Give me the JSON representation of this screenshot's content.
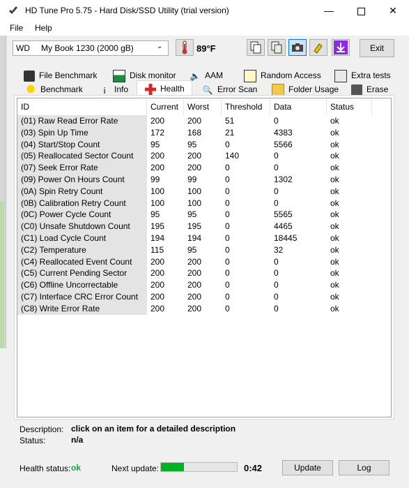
{
  "window": {
    "title": "HD Tune Pro 5.75 - Hard Disk/SSD Utility (trial version)"
  },
  "menu": {
    "file": "File",
    "help": "Help"
  },
  "toolbar": {
    "drive_brand": "WD",
    "drive_name": "My Book 1230 (2000 gB)",
    "temperature": "89°F",
    "exit_label": "Exit",
    "icons": [
      "copy-icon",
      "copy-text-icon",
      "camera-icon",
      "settings-icon",
      "save-download-icon"
    ]
  },
  "tabs_top": [
    "File Benchmark",
    "Disk monitor",
    "AAM",
    "Random Access",
    "Extra tests"
  ],
  "tabs_bottom": [
    "Benchmark",
    "Info",
    "Health",
    "Error Scan",
    "Folder Usage",
    "Erase"
  ],
  "active_tab": "Health",
  "table": {
    "headers": [
      "ID",
      "Current",
      "Worst",
      "Threshold",
      "Data",
      "Status"
    ],
    "rows": [
      [
        "(01) Raw Read Error Rate",
        "200",
        "200",
        "51",
        "0",
        "ok"
      ],
      [
        "(03) Spin Up Time",
        "172",
        "168",
        "21",
        "4383",
        "ok"
      ],
      [
        "(04) Start/Stop Count",
        "95",
        "95",
        "0",
        "5566",
        "ok"
      ],
      [
        "(05) Reallocated Sector Count",
        "200",
        "200",
        "140",
        "0",
        "ok"
      ],
      [
        "(07) Seek Error Rate",
        "200",
        "200",
        "0",
        "0",
        "ok"
      ],
      [
        "(09) Power On Hours Count",
        "99",
        "99",
        "0",
        "1302",
        "ok"
      ],
      [
        "(0A) Spin Retry Count",
        "100",
        "100",
        "0",
        "0",
        "ok"
      ],
      [
        "(0B) Calibration Retry Count",
        "100",
        "100",
        "0",
        "0",
        "ok"
      ],
      [
        "(0C) Power Cycle Count",
        "95",
        "95",
        "0",
        "5565",
        "ok"
      ],
      [
        "(C0) Unsafe Shutdown Count",
        "195",
        "195",
        "0",
        "4465",
        "ok"
      ],
      [
        "(C1) Load Cycle Count",
        "194",
        "194",
        "0",
        "18445",
        "ok"
      ],
      [
        "(C2) Temperature",
        "115",
        "95",
        "0",
        "32",
        "ok"
      ],
      [
        "(C4) Reallocated Event Count",
        "200",
        "200",
        "0",
        "0",
        "ok"
      ],
      [
        "(C5) Current Pending Sector",
        "200",
        "200",
        "0",
        "0",
        "ok"
      ],
      [
        "(C6) Offline Uncorrectable",
        "200",
        "200",
        "0",
        "0",
        "ok"
      ],
      [
        "(C7) Interface CRC Error Count",
        "200",
        "200",
        "0",
        "0",
        "ok"
      ],
      [
        "(C8) Write Error Rate",
        "200",
        "200",
        "0",
        "0",
        "ok"
      ]
    ]
  },
  "footer": {
    "description_label": "Description:",
    "description_value": "click on an item for a detailed description",
    "status_label": "Status:",
    "status_value": "n/a",
    "health_label": "Health status:",
    "health_value": "ok",
    "next_update_label": "Next update:",
    "next_update_value": "0:42",
    "progress_fraction": 0.3,
    "update_label": "Update",
    "log_label": "Log"
  },
  "colors": {
    "health_ok": "#16a83a",
    "progress": "#06b025",
    "thermometer": "#c0392b",
    "active_download": "#8a2be2"
  }
}
